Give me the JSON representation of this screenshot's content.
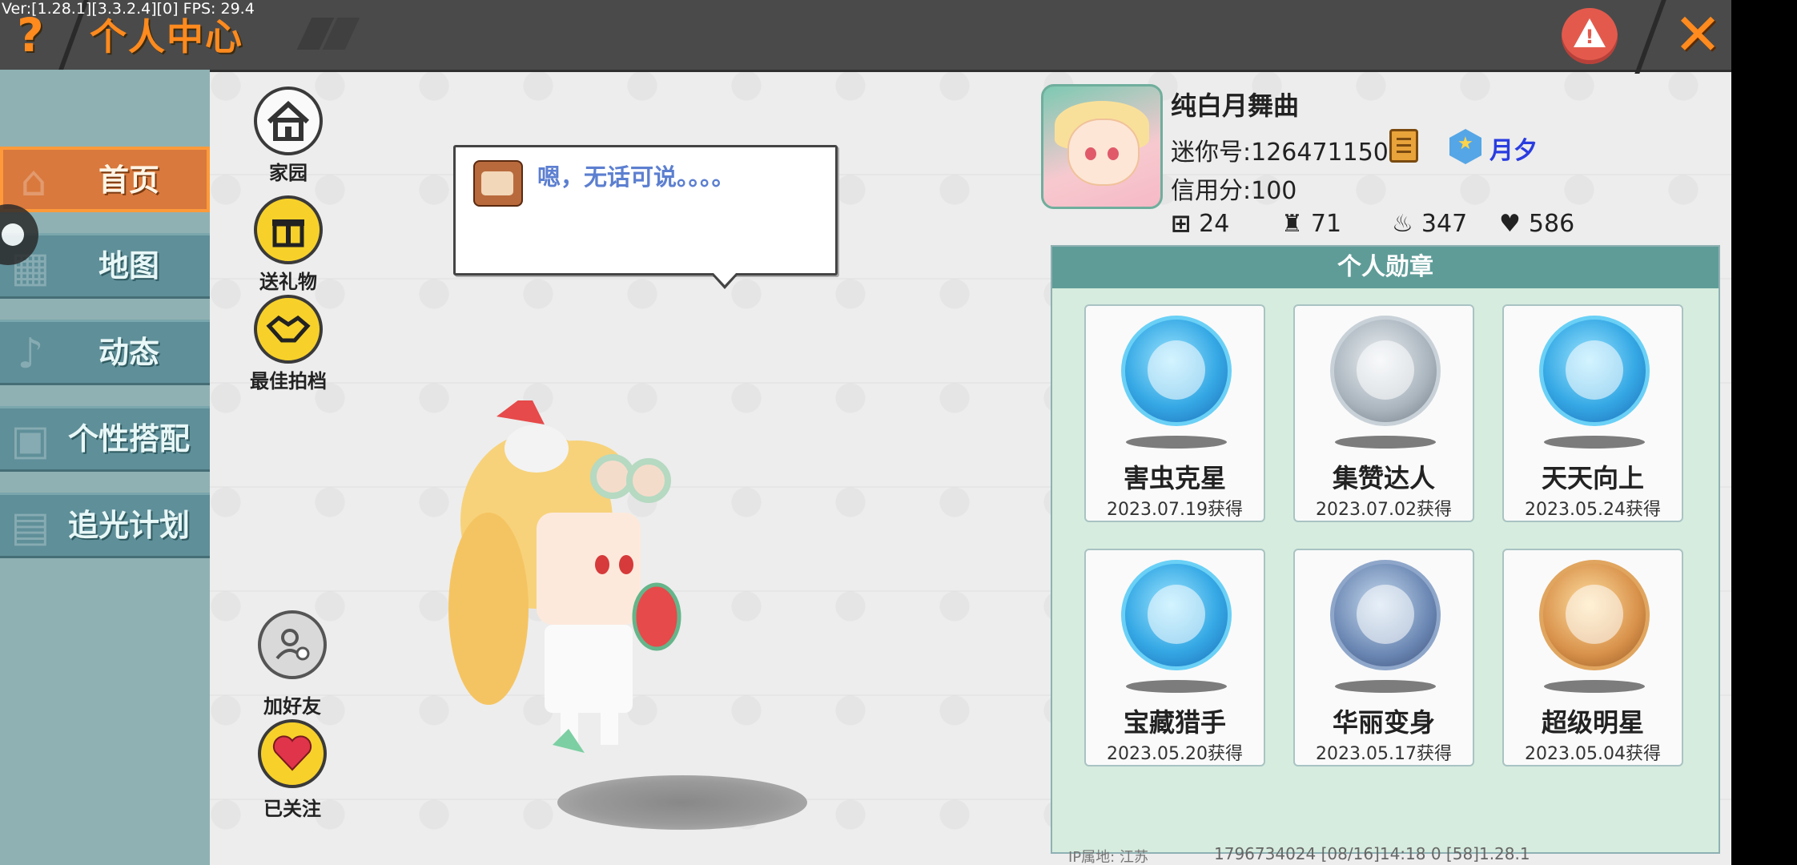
{
  "debug": {
    "version_text": "Ver:[1.28.1][3.3.2.4][0] FPS: 29.4"
  },
  "header": {
    "title": "个人中心",
    "help_glyph": "?",
    "close_glyph": "✕",
    "warn_glyph": "!"
  },
  "sidebar": {
    "items": [
      {
        "label": "首页",
        "icon": "house-icon",
        "active": true
      },
      {
        "label": "地图",
        "icon": "map-icon"
      },
      {
        "label": "动态",
        "icon": "bell-icon"
      },
      {
        "label": "个性搭配",
        "icon": "outfit-icon"
      },
      {
        "label": "追光计划",
        "icon": "light-plan-icon"
      }
    ]
  },
  "actions": {
    "home": "家园",
    "gift": "送礼物",
    "partner": "最佳拍档",
    "add_friend": "加好友",
    "followed": "已关注"
  },
  "speech": {
    "text": "嗯，无话可说。。。。"
  },
  "profile": {
    "name": "纯白月舞曲",
    "mini_id": "迷你号:1264711500",
    "badge_name": "月夕",
    "credit": "信用分:100",
    "stats": [
      {
        "icon": "plus-square-icon",
        "value": "24"
      },
      {
        "icon": "trophy-person-icon",
        "value": "71"
      },
      {
        "icon": "fire-icon",
        "value": "347"
      },
      {
        "icon": "hearts-icon",
        "value": "586"
      }
    ]
  },
  "medals": {
    "title": "个人勋章",
    "items": [
      {
        "name": "害虫克星",
        "date": "2023.07.19获得",
        "style": "blue"
      },
      {
        "name": "集赞达人",
        "date": "2023.07.02获得",
        "style": "silver"
      },
      {
        "name": "天天向上",
        "date": "2023.05.24获得",
        "style": "blue"
      },
      {
        "name": "宝藏猎手",
        "date": "2023.05.20获得",
        "style": "blue"
      },
      {
        "name": "华丽变身",
        "date": "2023.05.17获得",
        "style": "slate"
      },
      {
        "name": "超级明星",
        "date": "2023.05.04获得",
        "style": "bronze"
      }
    ]
  },
  "footer": {
    "ip_location": "IP属地: 江苏",
    "info": "1796734024    [08/16]14:18 0    [58]1.28.1"
  },
  "colors": {
    "accent": "#ff8a1e",
    "sidebar": "#5f8f99",
    "medal_header": "#5f9c98",
    "badge_text": "#2a3de0"
  }
}
